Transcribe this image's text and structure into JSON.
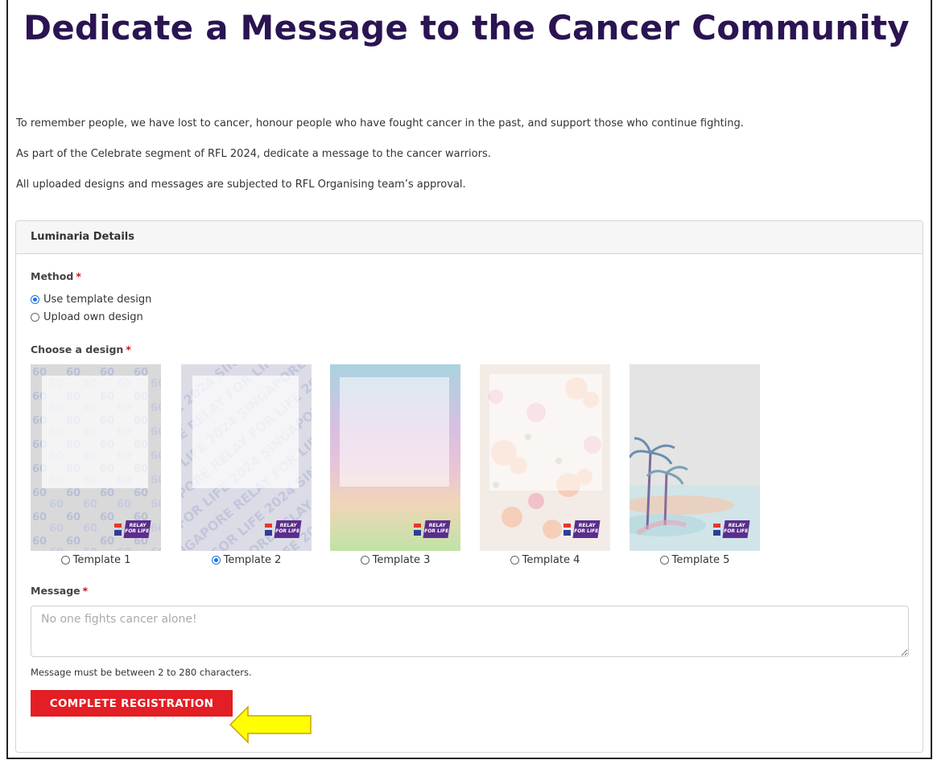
{
  "page": {
    "title": "Dedicate a Message to the Cancer Community",
    "intro": [
      "To remember people, we have lost to cancer, honour people who have fought cancer in the past, and support those who continue fighting.",
      "As part of the Celebrate segment of RFL 2024, dedicate a message to the cancer warriors.",
      "All uploaded designs and messages are subjected to RFL Organising team’s approval."
    ]
  },
  "panel": {
    "header": "Luminaria Details",
    "method": {
      "label": "Method",
      "required_mark": "*",
      "options": [
        {
          "label": "Use template design",
          "selected": true
        },
        {
          "label": "Upload own design",
          "selected": false
        }
      ]
    },
    "design": {
      "label": "Choose a design",
      "required_mark": "*",
      "templates": [
        {
          "label": "Template 1",
          "selected": false,
          "watermark": "60"
        },
        {
          "label": "Template 2",
          "selected": true,
          "watermark": "RELAY FOR LIFE 2024 SINGAPORE"
        },
        {
          "label": "Template 3",
          "selected": false
        },
        {
          "label": "Template 4",
          "selected": false
        },
        {
          "label": "Template 5",
          "selected": false
        }
      ],
      "logo_text": "RELAY FOR LIFE"
    },
    "message": {
      "label": "Message",
      "required_mark": "*",
      "value": "",
      "placeholder": "No one fights cancer alone!",
      "help": "Message must be between 2 to 280 characters."
    },
    "submit_label": "COMPLETE REGISTRATION"
  },
  "colors": {
    "title": "#2a1452",
    "required": "#d0121b",
    "submit_bg": "#e31e24",
    "arrow_fill": "#ffff00",
    "arrow_stroke": "#c9a400",
    "radio_accent": "#1a73e8"
  }
}
